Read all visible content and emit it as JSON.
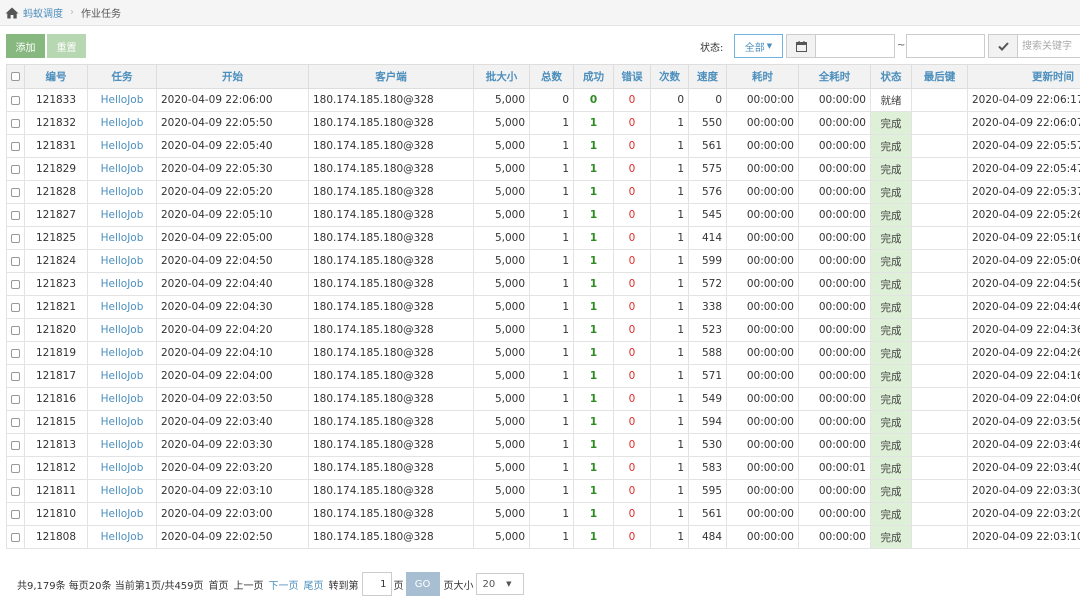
{
  "breadcrumb": {
    "home": "蚂蚁调度",
    "current": "作业任务"
  },
  "toolbar": {
    "add_label": "添加",
    "reset_label": "重置",
    "status_label": "状态:",
    "status_value": "全部",
    "date_sep": "~",
    "search_placeholder": "搜索关键字"
  },
  "table": {
    "headers": [
      "编号",
      "任务",
      "开始",
      "客户端",
      "批大小",
      "总数",
      "成功",
      "错误",
      "次数",
      "速度",
      "耗时",
      "全耗时",
      "状态",
      "最后键",
      "更新时间"
    ],
    "rows": [
      {
        "id": "121833",
        "task": "HelloJob",
        "start": "2020-04-09 22:06:00",
        "client": "180.174.185.180@328",
        "batch": "5,000",
        "total": "0",
        "success": "0",
        "error": "0",
        "times": "0",
        "speed": "0",
        "cost": "00:00:00",
        "total_cost": "00:00:00",
        "status": "就绪",
        "status_done": false,
        "last_key": "",
        "updated": "2020-04-09 22:06:17"
      },
      {
        "id": "121832",
        "task": "HelloJob",
        "start": "2020-04-09 22:05:50",
        "client": "180.174.185.180@328",
        "batch": "5,000",
        "total": "1",
        "success": "1",
        "error": "0",
        "times": "1",
        "speed": "550",
        "cost": "00:00:00",
        "total_cost": "00:00:00",
        "status": "完成",
        "status_done": true,
        "last_key": "",
        "updated": "2020-04-09 22:06:07"
      },
      {
        "id": "121831",
        "task": "HelloJob",
        "start": "2020-04-09 22:05:40",
        "client": "180.174.185.180@328",
        "batch": "5,000",
        "total": "1",
        "success": "1",
        "error": "0",
        "times": "1",
        "speed": "561",
        "cost": "00:00:00",
        "total_cost": "00:00:00",
        "status": "完成",
        "status_done": true,
        "last_key": "",
        "updated": "2020-04-09 22:05:57"
      },
      {
        "id": "121829",
        "task": "HelloJob",
        "start": "2020-04-09 22:05:30",
        "client": "180.174.185.180@328",
        "batch": "5,000",
        "total": "1",
        "success": "1",
        "error": "0",
        "times": "1",
        "speed": "575",
        "cost": "00:00:00",
        "total_cost": "00:00:00",
        "status": "完成",
        "status_done": true,
        "last_key": "",
        "updated": "2020-04-09 22:05:47"
      },
      {
        "id": "121828",
        "task": "HelloJob",
        "start": "2020-04-09 22:05:20",
        "client": "180.174.185.180@328",
        "batch": "5,000",
        "total": "1",
        "success": "1",
        "error": "0",
        "times": "1",
        "speed": "576",
        "cost": "00:00:00",
        "total_cost": "00:00:00",
        "status": "完成",
        "status_done": true,
        "last_key": "",
        "updated": "2020-04-09 22:05:37"
      },
      {
        "id": "121827",
        "task": "HelloJob",
        "start": "2020-04-09 22:05:10",
        "client": "180.174.185.180@328",
        "batch": "5,000",
        "total": "1",
        "success": "1",
        "error": "0",
        "times": "1",
        "speed": "545",
        "cost": "00:00:00",
        "total_cost": "00:00:00",
        "status": "完成",
        "status_done": true,
        "last_key": "",
        "updated": "2020-04-09 22:05:26"
      },
      {
        "id": "121825",
        "task": "HelloJob",
        "start": "2020-04-09 22:05:00",
        "client": "180.174.185.180@328",
        "batch": "5,000",
        "total": "1",
        "success": "1",
        "error": "0",
        "times": "1",
        "speed": "414",
        "cost": "00:00:00",
        "total_cost": "00:00:00",
        "status": "完成",
        "status_done": true,
        "last_key": "",
        "updated": "2020-04-09 22:05:16"
      },
      {
        "id": "121824",
        "task": "HelloJob",
        "start": "2020-04-09 22:04:50",
        "client": "180.174.185.180@328",
        "batch": "5,000",
        "total": "1",
        "success": "1",
        "error": "0",
        "times": "1",
        "speed": "599",
        "cost": "00:00:00",
        "total_cost": "00:00:00",
        "status": "完成",
        "status_done": true,
        "last_key": "",
        "updated": "2020-04-09 22:05:06"
      },
      {
        "id": "121823",
        "task": "HelloJob",
        "start": "2020-04-09 22:04:40",
        "client": "180.174.185.180@328",
        "batch": "5,000",
        "total": "1",
        "success": "1",
        "error": "0",
        "times": "1",
        "speed": "572",
        "cost": "00:00:00",
        "total_cost": "00:00:00",
        "status": "完成",
        "status_done": true,
        "last_key": "",
        "updated": "2020-04-09 22:04:56"
      },
      {
        "id": "121821",
        "task": "HelloJob",
        "start": "2020-04-09 22:04:30",
        "client": "180.174.185.180@328",
        "batch": "5,000",
        "total": "1",
        "success": "1",
        "error": "0",
        "times": "1",
        "speed": "338",
        "cost": "00:00:00",
        "total_cost": "00:00:00",
        "status": "完成",
        "status_done": true,
        "last_key": "",
        "updated": "2020-04-09 22:04:46"
      },
      {
        "id": "121820",
        "task": "HelloJob",
        "start": "2020-04-09 22:04:20",
        "client": "180.174.185.180@328",
        "batch": "5,000",
        "total": "1",
        "success": "1",
        "error": "0",
        "times": "1",
        "speed": "523",
        "cost": "00:00:00",
        "total_cost": "00:00:00",
        "status": "完成",
        "status_done": true,
        "last_key": "",
        "updated": "2020-04-09 22:04:36"
      },
      {
        "id": "121819",
        "task": "HelloJob",
        "start": "2020-04-09 22:04:10",
        "client": "180.174.185.180@328",
        "batch": "5,000",
        "total": "1",
        "success": "1",
        "error": "0",
        "times": "1",
        "speed": "588",
        "cost": "00:00:00",
        "total_cost": "00:00:00",
        "status": "完成",
        "status_done": true,
        "last_key": "",
        "updated": "2020-04-09 22:04:26"
      },
      {
        "id": "121817",
        "task": "HelloJob",
        "start": "2020-04-09 22:04:00",
        "client": "180.174.185.180@328",
        "batch": "5,000",
        "total": "1",
        "success": "1",
        "error": "0",
        "times": "1",
        "speed": "571",
        "cost": "00:00:00",
        "total_cost": "00:00:00",
        "status": "完成",
        "status_done": true,
        "last_key": "",
        "updated": "2020-04-09 22:04:16"
      },
      {
        "id": "121816",
        "task": "HelloJob",
        "start": "2020-04-09 22:03:50",
        "client": "180.174.185.180@328",
        "batch": "5,000",
        "total": "1",
        "success": "1",
        "error": "0",
        "times": "1",
        "speed": "549",
        "cost": "00:00:00",
        "total_cost": "00:00:00",
        "status": "完成",
        "status_done": true,
        "last_key": "",
        "updated": "2020-04-09 22:04:06"
      },
      {
        "id": "121815",
        "task": "HelloJob",
        "start": "2020-04-09 22:03:40",
        "client": "180.174.185.180@328",
        "batch": "5,000",
        "total": "1",
        "success": "1",
        "error": "0",
        "times": "1",
        "speed": "594",
        "cost": "00:00:00",
        "total_cost": "00:00:00",
        "status": "完成",
        "status_done": true,
        "last_key": "",
        "updated": "2020-04-09 22:03:56"
      },
      {
        "id": "121813",
        "task": "HelloJob",
        "start": "2020-04-09 22:03:30",
        "client": "180.174.185.180@328",
        "batch": "5,000",
        "total": "1",
        "success": "1",
        "error": "0",
        "times": "1",
        "speed": "530",
        "cost": "00:00:00",
        "total_cost": "00:00:00",
        "status": "完成",
        "status_done": true,
        "last_key": "",
        "updated": "2020-04-09 22:03:46"
      },
      {
        "id": "121812",
        "task": "HelloJob",
        "start": "2020-04-09 22:03:20",
        "client": "180.174.185.180@328",
        "batch": "5,000",
        "total": "1",
        "success": "1",
        "error": "0",
        "times": "1",
        "speed": "583",
        "cost": "00:00:00",
        "total_cost": "00:00:01",
        "status": "完成",
        "status_done": true,
        "last_key": "",
        "updated": "2020-04-09 22:03:40"
      },
      {
        "id": "121811",
        "task": "HelloJob",
        "start": "2020-04-09 22:03:10",
        "client": "180.174.185.180@328",
        "batch": "5,000",
        "total": "1",
        "success": "1",
        "error": "0",
        "times": "1",
        "speed": "595",
        "cost": "00:00:00",
        "total_cost": "00:00:00",
        "status": "完成",
        "status_done": true,
        "last_key": "",
        "updated": "2020-04-09 22:03:30"
      },
      {
        "id": "121810",
        "task": "HelloJob",
        "start": "2020-04-09 22:03:00",
        "client": "180.174.185.180@328",
        "batch": "5,000",
        "total": "1",
        "success": "1",
        "error": "0",
        "times": "1",
        "speed": "561",
        "cost": "00:00:00",
        "total_cost": "00:00:00",
        "status": "完成",
        "status_done": true,
        "last_key": "",
        "updated": "2020-04-09 22:03:20"
      },
      {
        "id": "121808",
        "task": "HelloJob",
        "start": "2020-04-09 22:02:50",
        "client": "180.174.185.180@328",
        "batch": "5,000",
        "total": "1",
        "success": "1",
        "error": "0",
        "times": "1",
        "speed": "484",
        "cost": "00:00:00",
        "total_cost": "00:00:00",
        "status": "完成",
        "status_done": true,
        "last_key": "",
        "updated": "2020-04-09 22:03:10"
      }
    ]
  },
  "pager": {
    "summary": "共9,179条 每页20条 当前第1页/共459页",
    "first": "首页",
    "prev": "上一页",
    "next": "下一页",
    "last": "尾页",
    "goto_label": "转到第",
    "page_value": "1",
    "page_suffix": "页",
    "go_label": "GO",
    "size_label": "页大小",
    "size_value": "20"
  },
  "colors": {
    "link": "#4c8fbd",
    "success": "#2e8b22",
    "error": "#e02d2d",
    "done_bg": "#dff0d8",
    "add_btn": "#87b87f"
  }
}
